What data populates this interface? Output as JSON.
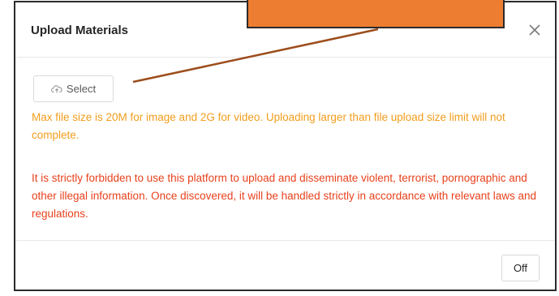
{
  "dialog": {
    "title": "Upload Materials",
    "select_label": "Select",
    "info_text": "Max file size is 20M for image and 2G for video. Uploading larger than file upload size limit will not complete.",
    "warning_text": "It is strictly forbidden to use this platform to upload and disseminate violent, terrorist, pornographic and other illegal information. Once discovered, it will be handled strictly in accordance with relevant laws and regulations.",
    "off_label": "Off"
  },
  "icons": {
    "close": "close-icon",
    "upload": "cloud-upload-icon"
  },
  "colors": {
    "info": "#f29d1b",
    "warning": "#e8411c",
    "callout": "#ed7d31",
    "arrow": "#9c4d1b"
  }
}
